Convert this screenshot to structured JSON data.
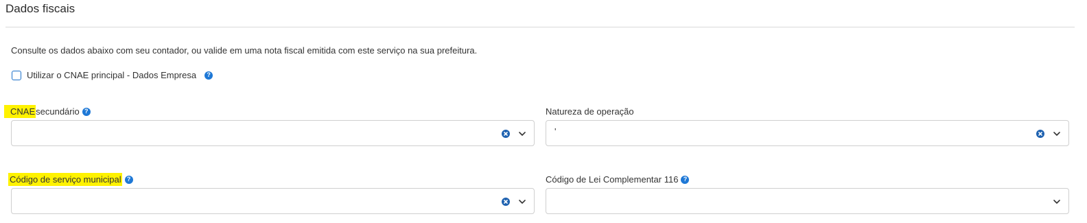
{
  "section": {
    "title": "Dados fiscais",
    "description": "Consulte os dados abaixo com seu contador, ou valide em uma nota fiscal emitida com este serviço na sua prefeitura."
  },
  "checkbox": {
    "label": "Utilizar o CNAE principal - Dados Empresa",
    "checked": false
  },
  "fields": {
    "cnae": {
      "label_highlight": "CNAE",
      "label_rest": " secundário",
      "value": ""
    },
    "natureza": {
      "label": "Natureza de operação",
      "value": "'"
    },
    "codigo_servico": {
      "label_highlight": "Código de serviço municipal",
      "value": ""
    },
    "codigo_lei": {
      "label": "Código de Lei Complementar 116",
      "value": ""
    }
  },
  "colors": {
    "accent": "#1e78d6",
    "highlight": "#fff200",
    "border": "#cfcfcf"
  },
  "icons": {
    "help": "question-circle",
    "clear": "x-circle",
    "dropdown": "chevron-down"
  }
}
